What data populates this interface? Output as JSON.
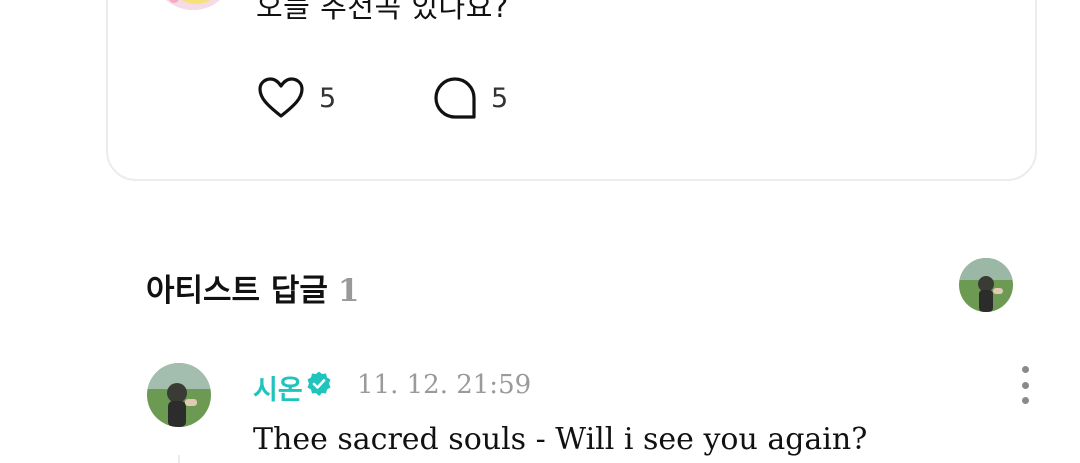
{
  "post": {
    "text": "오늘 추천곡 있나요?",
    "likes": "5",
    "comments": "5"
  },
  "artist_replies": {
    "title": "아티스트 답글",
    "count": "1"
  },
  "reply": {
    "author": "시온",
    "timestamp": "11. 12. 21:59",
    "text": "Thee sacred souls - Will i see you again?"
  },
  "colors": {
    "accent": "#20c4bd",
    "muted": "#9a9a9a"
  },
  "icons": [
    "heart-icon",
    "comment-bubble-icon",
    "verified-badge-icon",
    "more-options-icon"
  ]
}
